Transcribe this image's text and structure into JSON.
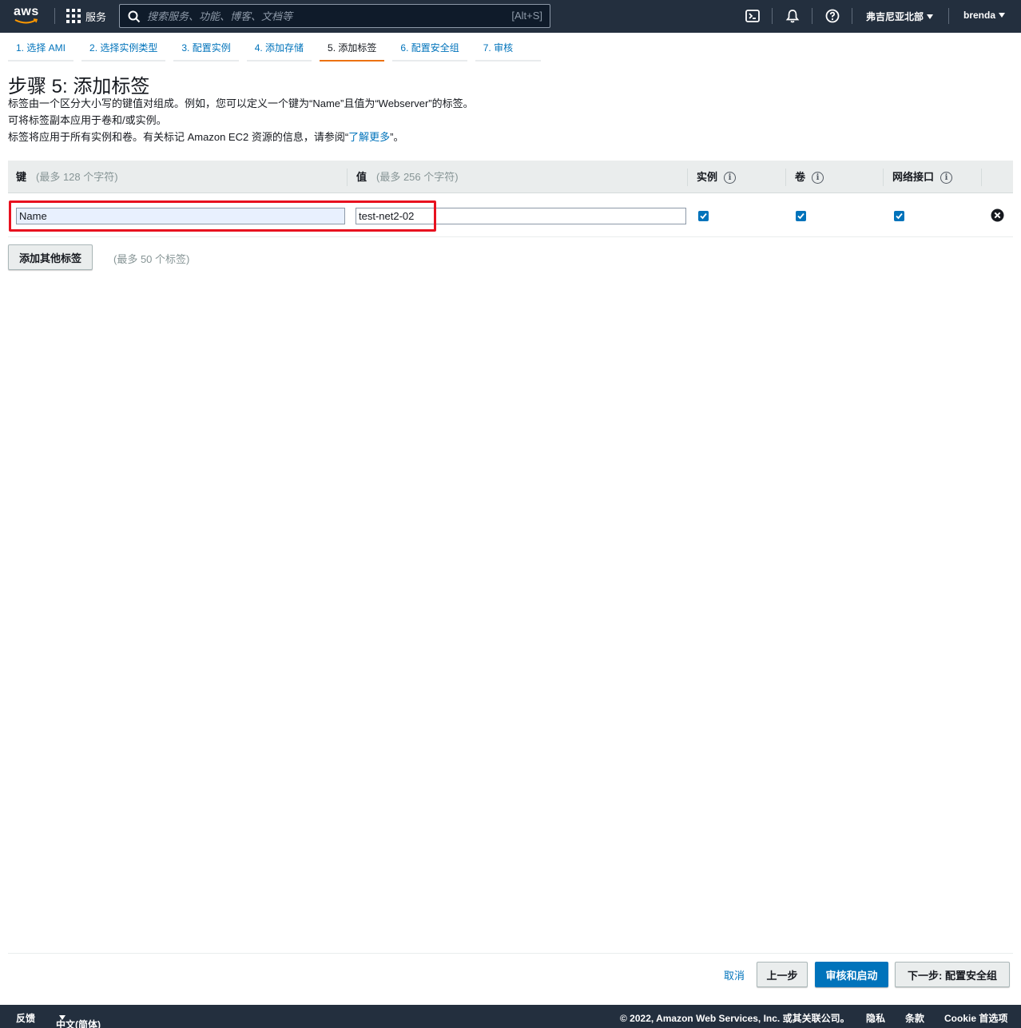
{
  "nav": {
    "logo": "aws",
    "services_label": "服务",
    "search_placeholder": "搜索服务、功能、博客、文档等",
    "search_shortcut": "[Alt+S]",
    "region": "弗吉尼亚北部",
    "user": "brenda",
    "icons": [
      "cloudshell-icon",
      "bell-icon",
      "help-icon"
    ]
  },
  "wizard": {
    "tabs": [
      {
        "label": "1. 选择 AMI"
      },
      {
        "label": "2. 选择实例类型"
      },
      {
        "label": "3. 配置实例"
      },
      {
        "label": "4. 添加存储"
      },
      {
        "label": "5. 添加标签"
      },
      {
        "label": "6. 配置安全组"
      },
      {
        "label": "7. 审核"
      }
    ],
    "active_tab": 4
  },
  "page": {
    "title": "步骤 5: 添加标签",
    "desc1": "标签由一个区分大小写的键值对组成。例如，您可以定义一个键为“Name”且值为“Webserver”的标签。",
    "desc2": "可将标签副本应用于卷和/或实例。",
    "desc3_prefix": "标签将应用于所有实例和卷。有关标记 Amazon EC2 资源的信息，请参阅“",
    "desc3_link": "了解更多",
    "desc3_suffix": "”。"
  },
  "table": {
    "headers": {
      "key": "键",
      "key_hint": "(最多 128 个字符)",
      "value": "值",
      "value_hint": "(最多 256 个字符)",
      "instances": "实例",
      "volumes": "卷",
      "network": "网络接口",
      "info": "i"
    },
    "rows": [
      {
        "key": "Name",
        "value": "test-net2-02",
        "instances": true,
        "volumes": true,
        "network": true
      }
    ]
  },
  "actions": {
    "add_tag": "添加其他标签",
    "add_tag_hint": "(最多 50 个标签)",
    "cancel": "取消",
    "previous": "上一步",
    "review_launch": "审核和启动",
    "next": "下一步: 配置安全组"
  },
  "footer": {
    "feedback": "反馈",
    "language": "中文(简体)",
    "copyright": "© 2022, Amazon Web Services, Inc. 或其关联公司。",
    "privacy": "隐私",
    "terms": "条款",
    "cookie": "Cookie 首选项"
  },
  "colors": {
    "nav_bg": "#232f3e",
    "link": "#0073bb",
    "active_tab_underline": "#ec7211",
    "highlight_box": "#e8111f",
    "primary_button": "#0073bb"
  }
}
